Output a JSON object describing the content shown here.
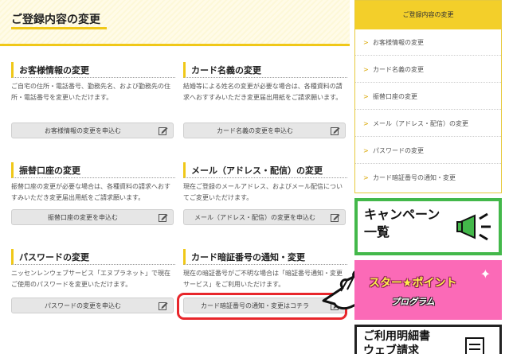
{
  "page": {
    "title": "ご登録内容の変更"
  },
  "cards": [
    {
      "title": "お客様情報の変更",
      "desc": "ご自宅の住所・電話番号、勤務先名、および勤務先の住所・電話番号を変更いただけます。",
      "button": "お客様情報の変更を申込む"
    },
    {
      "title": "カード名義の変更",
      "desc": "結婚等による姓名の変更が必要な場合は、各種資料の請求へおすすみいただき変更届出用紙をご請求願います。",
      "button": "カード名義の変更を申込む"
    },
    {
      "title": "振替口座の変更",
      "desc": "振替口座の変更が必要な場合は、各種資料の請求へおすすみいただき変更届出用紙をご請求願います。",
      "button": "振替口座の変更を申込む"
    },
    {
      "title": "メール（アドレス・配信）の変更",
      "desc": "現在ご登録のメールアドレス、およびメール配信についてご変更いただけます。",
      "button": "メール（アドレス・配信）の変更を申込む"
    },
    {
      "title": "パスワードの変更",
      "desc": "ニッセンレンウェブサービス「エヌプラネット」で現在ご使用のパスワードを変更いただけます。",
      "button": "パスワードの変更を申込む"
    },
    {
      "title": "カード暗証番号の通知・変更",
      "desc": "現在の暗証番号がご不明な場合は「暗証番号通知・変更サービス」をご利用いただけます。",
      "button": "カード暗証番号の通知・変更はコチラ"
    }
  ],
  "sidebar": {
    "heading": "ご登録内容の変更",
    "items": [
      "お客様情報の変更",
      "カード名義の変更",
      "振替口座の変更",
      "メール（アドレス・配信）の変更",
      "パスワードの変更",
      "カード暗証番号の通知・変更"
    ],
    "arrow": ">",
    "banners": {
      "campaign_line1": "キャンペーン",
      "campaign_line2": "一覧",
      "star_point": "スター★ポイント",
      "star_program": "プログラム",
      "detail_line1": "ご利用明細書",
      "detail_line2": "ウェブ請求"
    }
  },
  "colors": {
    "accent": "#f0c818",
    "highlight": "#e8262b",
    "campaign_border": "#43b84a",
    "star_bg": "#fb6ab7"
  }
}
